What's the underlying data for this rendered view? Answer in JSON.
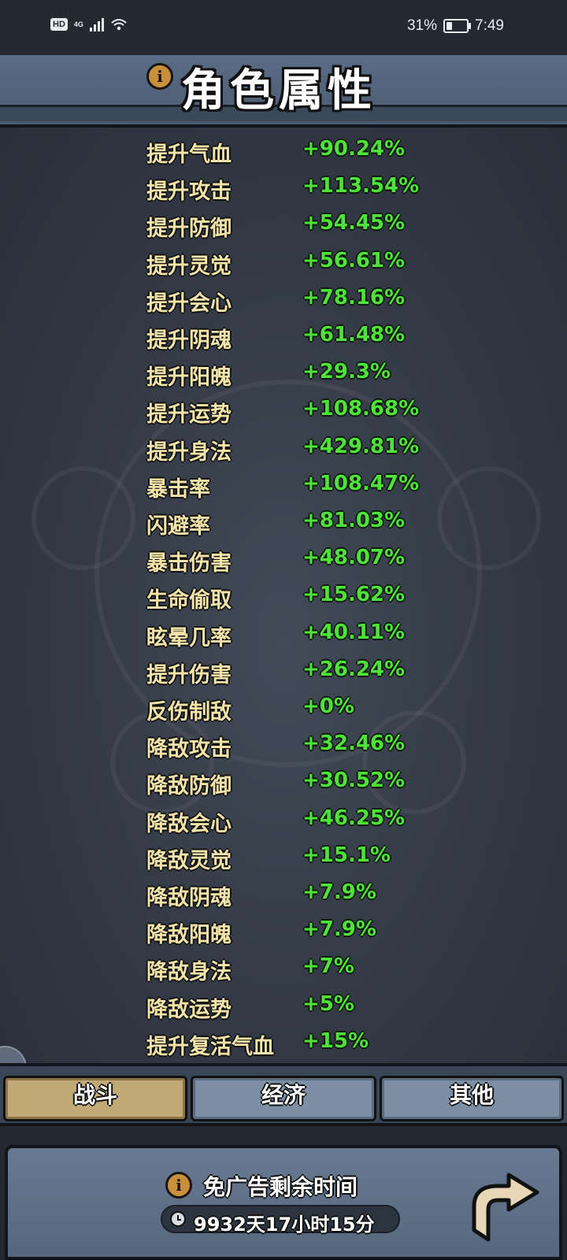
{
  "status_bar": {
    "hd": "HD",
    "network": "4G",
    "battery": "31%",
    "battery_level": 0.31,
    "time": "7:49",
    "icons": [
      "signal-icon",
      "wifi-icon",
      "battery-icon"
    ]
  },
  "header": {
    "title": "角色属性",
    "info_icon": "info-icon"
  },
  "stats": [
    {
      "name": "提升气血",
      "value": "+90.24%"
    },
    {
      "name": "提升攻击",
      "value": "+113.54%"
    },
    {
      "name": "提升防御",
      "value": "+54.45%"
    },
    {
      "name": "提升灵觉",
      "value": "+56.61%"
    },
    {
      "name": "提升会心",
      "value": "+78.16%"
    },
    {
      "name": "提升阴魂",
      "value": "+61.48%"
    },
    {
      "name": "提升阳魄",
      "value": "+29.3%"
    },
    {
      "name": "提升运势",
      "value": "+108.68%"
    },
    {
      "name": "提升身法",
      "value": "+429.81%"
    },
    {
      "name": "暴击率",
      "value": "+108.47%"
    },
    {
      "name": "闪避率",
      "value": "+81.03%"
    },
    {
      "name": "暴击伤害",
      "value": "+48.07%"
    },
    {
      "name": "生命偷取",
      "value": "+15.62%"
    },
    {
      "name": "眩晕几率",
      "value": "+40.11%"
    },
    {
      "name": "提升伤害",
      "value": "+26.24%"
    },
    {
      "name": "反伤制敌",
      "value": "+0%"
    },
    {
      "name": "降敌攻击",
      "value": "+32.46%"
    },
    {
      "name": "降敌防御",
      "value": "+30.52%"
    },
    {
      "name": "降敌会心",
      "value": "+46.25%"
    },
    {
      "name": "降敌灵觉",
      "value": "+15.1%"
    },
    {
      "name": "降敌阴魂",
      "value": "+7.9%"
    },
    {
      "name": "降敌阳魄",
      "value": "+7.9%"
    },
    {
      "name": "降敌身法",
      "value": "+7%"
    },
    {
      "name": "降敌运势",
      "value": "+5%"
    },
    {
      "name": "提升复活气血",
      "value": "+15%"
    }
  ],
  "tabs": [
    {
      "label": "战斗",
      "active": true
    },
    {
      "label": "经济",
      "active": false
    },
    {
      "label": "其他",
      "active": false
    }
  ],
  "footer": {
    "ad_free_label": "免广告剩余时间",
    "timer": "9932天17小时15分",
    "clock_icon": "clock-icon",
    "back_icon": "back-arrow-icon"
  },
  "colors": {
    "stat_name": "#f2e3a8",
    "stat_value": "#4fe23a",
    "tab_active": "#c2aa78",
    "tab_inactive": "#7d8fa4"
  }
}
